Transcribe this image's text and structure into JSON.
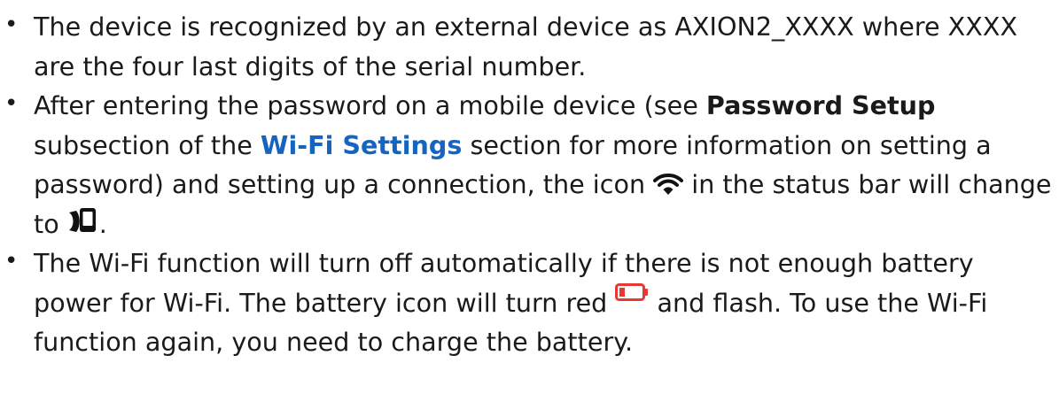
{
  "bullets": [
    {
      "text": "The device is recognized by an external device as AXION2_XXXX where XXXX are the four last digits of the serial number."
    },
    {
      "part1": "After entering the password on a mobile device (see ",
      "bold1": "Password Setup",
      "part2": " subsection of the ",
      "link1": "Wi-Fi Settings",
      "part3": " section for more information on setting a password) and setting up a connection, the icon ",
      "part4": " in the status bar will change to ",
      "part5": "."
    },
    {
      "part1": "The Wi-Fi function will turn off automatically if there is not enough battery power for Wi-Fi. The battery icon will turn red ",
      "part2": " and flash. To use the Wi-Fi function again, you need to charge the battery."
    }
  ],
  "icons": {
    "wifi": "wifi-icon",
    "phone_signal": "phone-signal-icon",
    "battery_low": "battery-low-icon"
  },
  "colors": {
    "link": "#1565c0",
    "battery_red": "#e53935",
    "text": "#1a1a1a"
  }
}
